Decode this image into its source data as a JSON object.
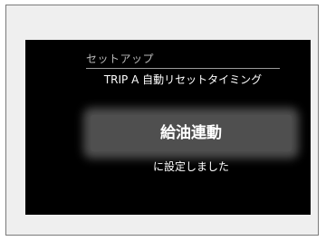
{
  "screen": {
    "header": "セットアップ",
    "subtitle": "TRIP A 自動リセットタイミング",
    "selected_value": "給油連動",
    "message": "に設定しました"
  }
}
